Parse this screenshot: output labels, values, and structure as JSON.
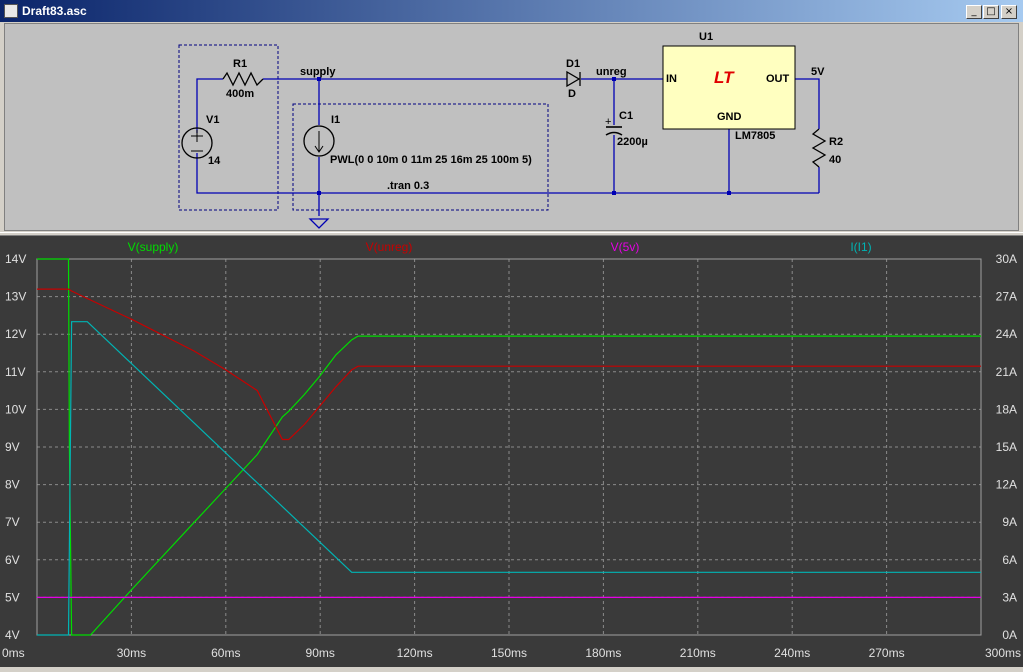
{
  "window": {
    "title": "Draft83.asc",
    "buttons": {
      "minimize": "_",
      "maximize": "□",
      "close": "×"
    }
  },
  "schematic": {
    "background": "#c0c0c0",
    "wire_color": "#0000b4",
    "nets": {
      "supply": "supply",
      "unreg": "unreg",
      "out": "5V"
    },
    "R1": {
      "name": "R1",
      "value": "400m"
    },
    "V1": {
      "name": "V1",
      "value": "14"
    },
    "I1": {
      "name": "I1",
      "value": "PWL(0 0 10m 0 11m 25 16m 25 100m 5)"
    },
    "D1": {
      "name": "D1",
      "value": "D"
    },
    "C1": {
      "name": "C1",
      "value": "2200µ",
      "plus": "+"
    },
    "U1": {
      "name": "U1",
      "model": "LM7805",
      "pin_in": "IN",
      "pin_out": "OUT",
      "pin_gnd": "GND",
      "logo": "LT"
    },
    "R2": {
      "name": "R2",
      "value": "40"
    },
    "directive": ".tran 0.3"
  },
  "plot": {
    "background": "#3a3a3a",
    "traces": [
      {
        "label": "V(supply)",
        "color": "#00dc00"
      },
      {
        "label": "V(unreg)",
        "color": "#c80000"
      },
      {
        "label": "V(5v)",
        "color": "#e600e6"
      },
      {
        "label": "I(I1)",
        "color": "#00b4b4"
      }
    ],
    "left_ticks": [
      "14V",
      "13V",
      "12V",
      "11V",
      "10V",
      "9V",
      "8V",
      "7V",
      "6V",
      "5V",
      "4V"
    ],
    "right_ticks": [
      "30A",
      "27A",
      "24A",
      "21A",
      "18A",
      "15A",
      "12A",
      "9A",
      "6A",
      "3A",
      "0A"
    ],
    "x_ticks": [
      "0ms",
      "30ms",
      "60ms",
      "90ms",
      "120ms",
      "150ms",
      "180ms",
      "210ms",
      "240ms",
      "270ms",
      "300ms"
    ]
  },
  "chart_data": {
    "type": "line",
    "x_unit": "ms",
    "xlim": [
      0,
      300
    ],
    "ylim_left": [
      4,
      14
    ],
    "ylim_right": [
      0,
      30
    ],
    "grid": true,
    "series": [
      {
        "name": "V(supply)",
        "axis": "left",
        "unit": "V",
        "x": [
          0,
          10,
          10.3,
          11,
          16,
          17,
          30,
          50,
          60,
          70,
          78,
          80,
          85,
          90,
          95,
          100,
          102,
          300
        ],
        "y": [
          14,
          14,
          9.0,
          4.0,
          4.0,
          4.0,
          5.2,
          7.0,
          7.9,
          8.8,
          9.8,
          9.95,
          10.4,
          10.9,
          11.45,
          11.85,
          11.95,
          11.95
        ]
      },
      {
        "name": "V(unreg)",
        "axis": "left",
        "unit": "V",
        "x": [
          0,
          10,
          11,
          16,
          30,
          50,
          60,
          70,
          78,
          80,
          85,
          90,
          95,
          100,
          102,
          300
        ],
        "y": [
          13.2,
          13.2,
          13.15,
          12.95,
          12.4,
          11.55,
          11.05,
          10.5,
          9.2,
          9.2,
          9.6,
          10.1,
          10.6,
          11.05,
          11.15,
          11.15
        ]
      },
      {
        "name": "V(5v)",
        "axis": "left",
        "unit": "V",
        "x": [
          0,
          300
        ],
        "y": [
          5.0,
          5.0
        ]
      },
      {
        "name": "I(I1)",
        "axis": "right",
        "unit": "A",
        "x": [
          0,
          10,
          11,
          16,
          100,
          300
        ],
        "y": [
          0,
          0,
          25,
          25,
          5,
          5
        ]
      }
    ]
  }
}
